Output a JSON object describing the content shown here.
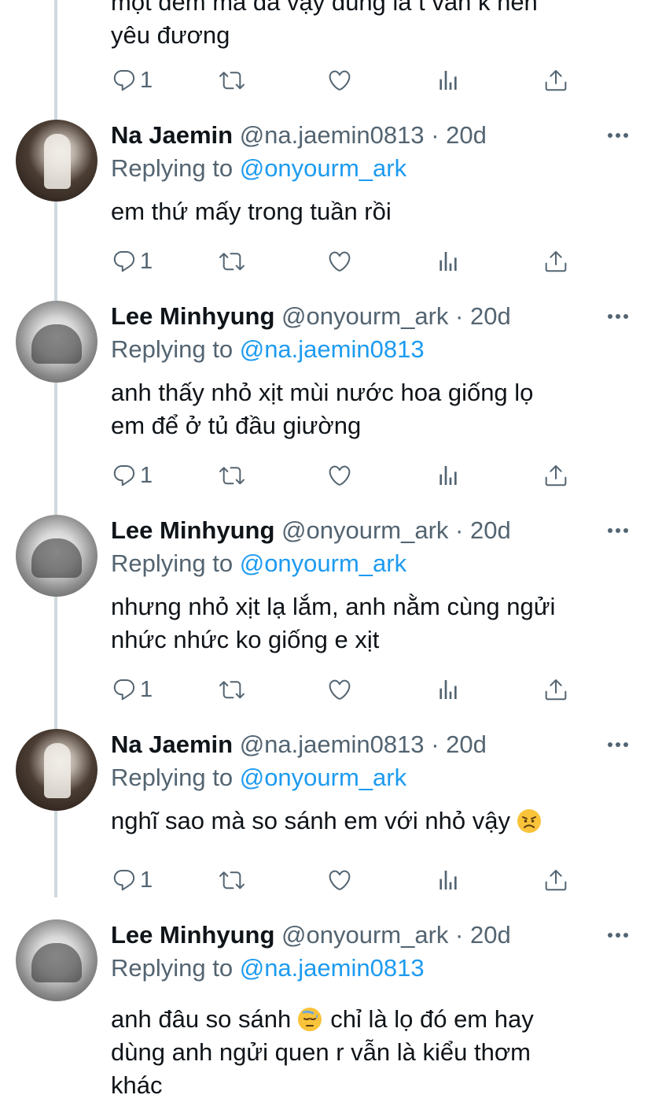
{
  "top_tweet": {
    "lines": [
      "một đêm mà đã vậy đúng là t vẫn k nên",
      "yêu đương"
    ],
    "reply_count": "1"
  },
  "tweets": [
    {
      "name": "Na Jaemin",
      "handle": "@na.jaemin0813",
      "sep": "·",
      "time": "20d",
      "replying_label": "Replying to",
      "replying_to": "@onyourm_ark",
      "lines": [
        "em thứ mấy trong tuần rồi"
      ],
      "reply_count": "1"
    },
    {
      "name": "Lee Minhyung",
      "handle": "@onyourm_ark",
      "sep": "·",
      "time": "20d",
      "replying_label": "Replying to",
      "replying_to": "@na.jaemin0813",
      "lines": [
        "anh thấy nhỏ xịt mùi nước hoa giống lọ",
        "em để ở tủ đầu giường"
      ],
      "reply_count": "1"
    },
    {
      "name": "Lee Minhyung",
      "handle": "@onyourm_ark",
      "sep": "·",
      "time": "20d",
      "replying_label": "Replying to",
      "replying_to": "@onyourm_ark",
      "lines": [
        "nhưng nhỏ xịt lạ lắm, anh nằm cùng ngửi",
        "nhức nhức ko giống e xịt"
      ],
      "reply_count": "1"
    },
    {
      "name": "Na Jaemin",
      "handle": "@na.jaemin0813",
      "sep": "·",
      "time": "20d",
      "replying_label": "Replying to",
      "replying_to": "@onyourm_ark",
      "lines": [
        "nghĩ sao mà so sánh em với nhỏ vậy"
      ],
      "emoji": "angry-face",
      "reply_count": "1"
    },
    {
      "name": "Lee Minhyung",
      "handle": "@onyourm_ark",
      "sep": "·",
      "time": "20d",
      "replying_label": "Replying to",
      "replying_to": "@na.jaemin0813",
      "line1_a": "anh đâu so sánh",
      "emoji": "downcast-sweat-face",
      "line1_b": "chỉ là lọ đó em hay",
      "lines_rest": [
        "dùng anh ngửi quen r vẫn là kiểu thơm",
        "khác"
      ]
    }
  ],
  "colors": {
    "text": "#0f1419",
    "secondary": "#536471",
    "accent": "#1d9bf0",
    "thread_line": "#cfd9de"
  },
  "icons": [
    "reply-icon",
    "retweet-icon",
    "like-icon",
    "analytics-icon",
    "share-icon",
    "more-icon",
    "angry-face-emoji",
    "downcast-sweat-face-emoji"
  ]
}
